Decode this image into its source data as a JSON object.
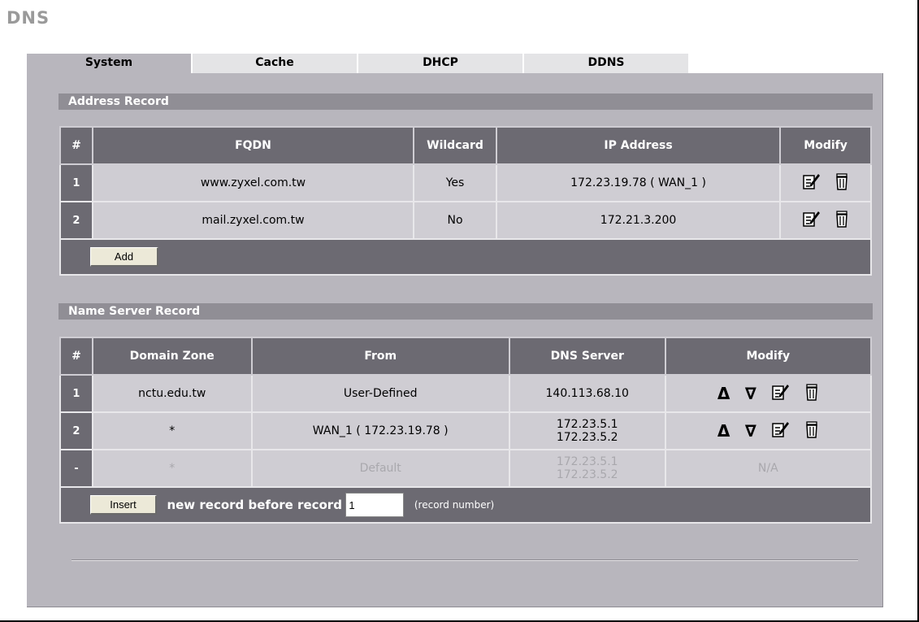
{
  "page": {
    "title": "DNS"
  },
  "tabs": [
    {
      "label": "System",
      "active": true
    },
    {
      "label": "Cache",
      "active": false
    },
    {
      "label": "DHCP",
      "active": false
    },
    {
      "label": "DDNS",
      "active": false
    }
  ],
  "address_record": {
    "title": "Address Record",
    "columns": [
      "#",
      "FQDN",
      "Wildcard",
      "IP Address",
      "Modify"
    ],
    "rows": [
      {
        "num": "1",
        "fqdn": "www.zyxel.com.tw",
        "wildcard": "Yes",
        "ip": "172.23.19.78 ( WAN_1 )"
      },
      {
        "num": "2",
        "fqdn": "mail.zyxel.com.tw",
        "wildcard": "No",
        "ip": "172.21.3.200"
      }
    ],
    "add_label": "Add"
  },
  "name_server_record": {
    "title": "Name Server Record",
    "columns": [
      "#",
      "Domain Zone",
      "From",
      "DNS Server",
      "Modify"
    ],
    "rows": [
      {
        "num": "1",
        "zone": "nctu.edu.tw",
        "from": "User-Defined",
        "dns1": "140.113.68.10",
        "dns2": ""
      },
      {
        "num": "2",
        "zone": "*",
        "from": "WAN_1 ( 172.23.19.78 )",
        "dns1": "172.23.5.1",
        "dns2": "172.23.5.2"
      },
      {
        "num": "-",
        "zone": "*",
        "from": "Default",
        "dns1": "172.23.5.1",
        "dns2": "172.23.5.2",
        "modify": "N/A"
      }
    ],
    "insert_label": "Insert",
    "insert_text": "new record before record",
    "record_value": "1",
    "hint": "(record number)"
  },
  "icons": {
    "edit": "edit-icon",
    "delete": "trash-icon",
    "up": "move-up-icon",
    "down": "move-down-icon"
  },
  "colors": {
    "panel": "#b8b6bd",
    "header": "#6c6a72",
    "cell": "#cfcdd3",
    "title": "#9a9a9a"
  }
}
